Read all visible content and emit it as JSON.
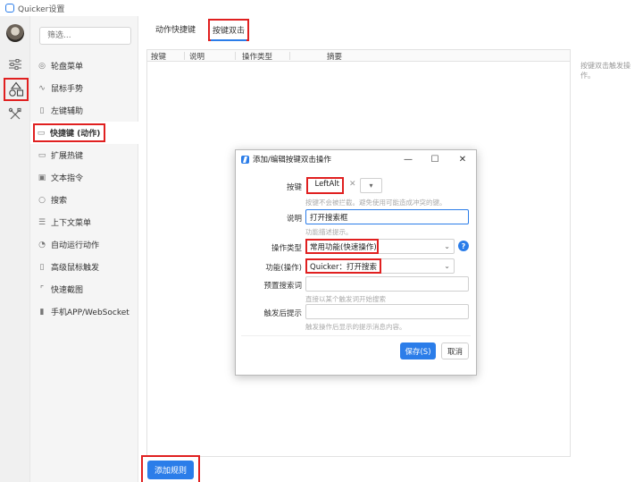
{
  "window": {
    "title": "Quicker设置"
  },
  "rail": {
    "items": [
      "avatar",
      "sliders-icon",
      "shapes-icon",
      "tools-icon"
    ]
  },
  "sidebar": {
    "search_placeholder": "筛选...",
    "items": [
      {
        "label": "轮盘菜单",
        "icon": "wheel-icon"
      },
      {
        "label": "鼠标手势",
        "icon": "gesture-icon"
      },
      {
        "label": "左键辅助",
        "icon": "mouse-icon"
      },
      {
        "label": "快捷键 (动作)",
        "icon": "keyboard-icon"
      },
      {
        "label": "扩展热键",
        "icon": "keyboard-icon"
      },
      {
        "label": "文本指令",
        "icon": "text-icon"
      },
      {
        "label": "搜索",
        "icon": "search-icon"
      },
      {
        "label": "上下文菜单",
        "icon": "menu-icon"
      },
      {
        "label": "自动运行动作",
        "icon": "alarm-icon"
      },
      {
        "label": "高级鼠标触发",
        "icon": "mouse-icon"
      },
      {
        "label": "快速截图",
        "icon": "crop-icon"
      },
      {
        "label": "手机APP/WebSocket",
        "icon": "phone-icon"
      }
    ]
  },
  "tabs": [
    {
      "label": "动作快捷键"
    },
    {
      "label": "按键双击"
    }
  ],
  "grid": {
    "columns": [
      "按键",
      "说明",
      "操作类型",
      "摘要"
    ]
  },
  "hint": "按键双击触发操作。",
  "add_button": "添加规则",
  "dialog": {
    "title": "添加/编辑按键双击操作",
    "fields": {
      "key": {
        "label": "按键",
        "value": "LeftAlt",
        "help": "按键不会被拦截。避免使用可能造成冲突的键。"
      },
      "desc": {
        "label": "说明",
        "value": "打开搜索框",
        "help": "功能描述提示。"
      },
      "op_type": {
        "label": "操作类型",
        "value": "常用功能(快速操作)"
      },
      "func": {
        "label": "功能(操作)",
        "value": "Quicker：打开搜索"
      },
      "preset": {
        "label": "预置搜索词",
        "value": "",
        "help": "直接以某个触发词开始搜索"
      },
      "after": {
        "label": "触发后提示",
        "value": "",
        "help": "触发操作后显示的提示消息内容。"
      }
    },
    "save": "保存(S)",
    "cancel": "取消"
  }
}
